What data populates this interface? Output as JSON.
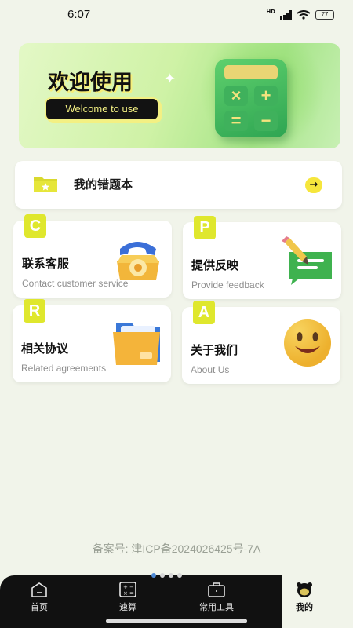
{
  "status_bar": {
    "time": "6:07",
    "network": "HD",
    "battery": "77"
  },
  "banner": {
    "title": "欢迎使用",
    "subtitle": "Welcome to use",
    "calculator_keys": [
      "×",
      "+",
      "=",
      "−"
    ]
  },
  "mistakes": {
    "label": "我的错题本",
    "arrow": "→"
  },
  "tiles": [
    {
      "badge": "C",
      "title": "联系客服",
      "subtitle": "Contact customer service",
      "icon": "phone-icon"
    },
    {
      "badge": "P",
      "title": "提供反映",
      "subtitle": "Provide feedback",
      "icon": "chat-icon"
    },
    {
      "badge": "R",
      "title": "相关协议",
      "subtitle": "Related agreements",
      "icon": "folder-icon"
    },
    {
      "badge": "A",
      "title": "关于我们",
      "subtitle": "About Us",
      "icon": "smiley-icon"
    }
  ],
  "filing": "备案号: 津ICP备2024026425号-7A",
  "tabs": [
    {
      "label": "首页",
      "icon": "home-icon",
      "active": false
    },
    {
      "label": "速算",
      "icon": "calculator-icon",
      "active": false
    },
    {
      "label": "常用工具",
      "icon": "toolbox-icon",
      "active": false
    },
    {
      "label": "我的",
      "icon": "profile-icon",
      "active": true
    }
  ],
  "colors": {
    "accent_yellow": "#dfe72d",
    "tab_bar": "#111111",
    "background": "#f1f4ea"
  }
}
